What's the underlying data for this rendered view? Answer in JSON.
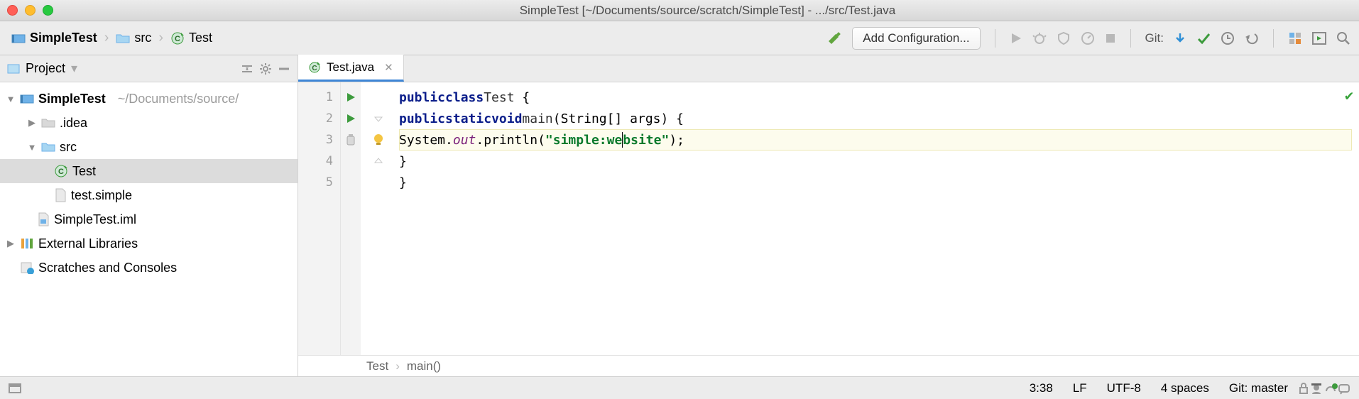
{
  "titlebar": {
    "title": "SimpleTest [~/Documents/source/scratch/SimpleTest] - .../src/Test.java"
  },
  "breadcrumbs": {
    "project": "SimpleTest",
    "folder": "src",
    "file": "Test"
  },
  "toolbar": {
    "add_config_label": "Add Configuration...",
    "git_label": "Git:"
  },
  "sidebar": {
    "title": "Project",
    "project_name": "SimpleTest",
    "project_path": "~/Documents/source/",
    "items": [
      {
        "label": ".idea"
      },
      {
        "label": "src"
      },
      {
        "label": "Test"
      },
      {
        "label": "test.simple"
      },
      {
        "label": "SimpleTest.iml"
      }
    ],
    "external_libs": "External Libraries",
    "scratches": "Scratches and Consoles"
  },
  "editor": {
    "tab_label": "Test.java",
    "code_crumb_class": "Test",
    "code_crumb_method": "main()",
    "lines": {
      "l1": {
        "num": "1"
      },
      "l2": {
        "num": "2"
      },
      "l3": {
        "num": "3"
      },
      "l4": {
        "num": "4"
      },
      "l5": {
        "num": "5"
      }
    },
    "code": {
      "kw_public": "public",
      "kw_class": "class",
      "class_name": "Test",
      "kw_static": "static",
      "kw_void": "void",
      "method": "main",
      "params": "(String[] args)",
      "lbrace": " {",
      "sysout_prefix": "System.",
      "sysout_field": "out",
      "sysout_suffix": ".println(",
      "string_literal_a": "\"simple:we",
      "string_literal_b": "bsite\"",
      "stmt_end": ");",
      "rbrace1": "}",
      "rbrace0": "}"
    }
  },
  "status": {
    "pos": "3:38",
    "line_end": "LF",
    "encoding": "UTF-8",
    "indent": "4 spaces",
    "git": "Git: master"
  }
}
